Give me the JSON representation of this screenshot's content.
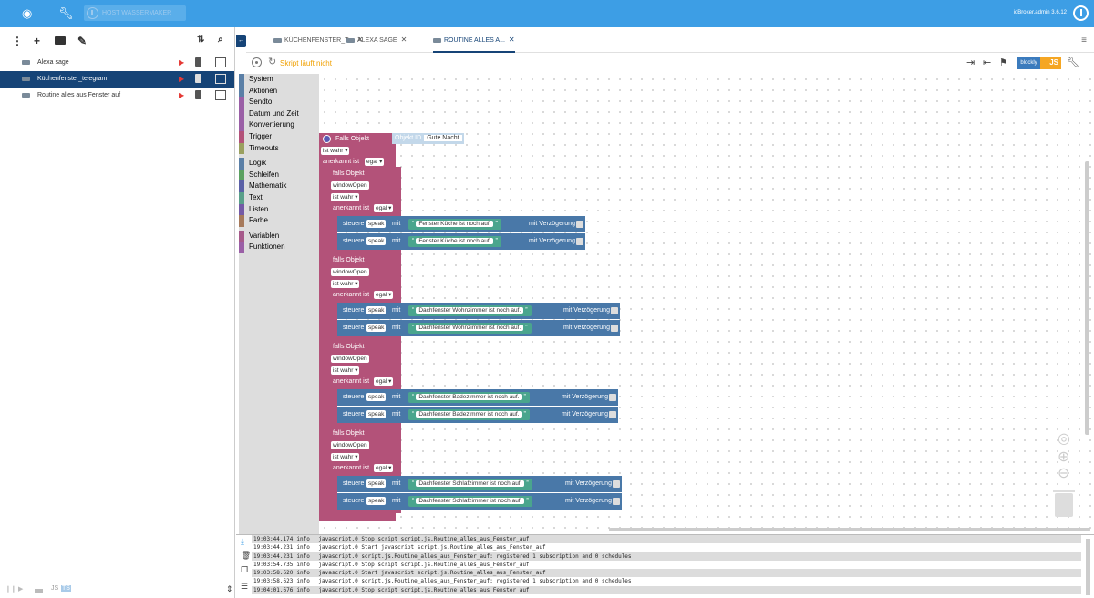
{
  "topbar": {
    "host_button": "HOST WASSERMAKER",
    "admin_label": "ioBroker.admin 3.6.12"
  },
  "sidebar": {
    "scripts": [
      {
        "name": "Alexa sage",
        "selected": false
      },
      {
        "name": "Küchenfenster_telegram",
        "selected": true
      },
      {
        "name": "Routine alles aus Fenster auf",
        "selected": false
      }
    ],
    "footer": {
      "js": "JS",
      "ts": "TS"
    }
  },
  "tabs": [
    {
      "label": "KÜCHENFENSTER_T...",
      "active": false
    },
    {
      "label": "ALEXA SAGE",
      "active": false
    },
    {
      "label": "ROUTINE ALLES A...",
      "active": true
    }
  ],
  "script_toolbar": {
    "status": "Skript läuft nicht",
    "blockly_label": "blockly",
    "js_label": "JS"
  },
  "toolbox": {
    "categories": [
      {
        "label": "System",
        "color": "#5a7fa6"
      },
      {
        "label": "Aktionen",
        "color": "#5a7fa6"
      },
      {
        "label": "Sendto",
        "color": "#9a5fa6"
      },
      {
        "label": "Datum und Zeit",
        "color": "#9a5fa6"
      },
      {
        "label": "Konvertierung",
        "color": "#9a5fa6"
      },
      {
        "label": "Trigger",
        "color": "#b35279"
      },
      {
        "label": "Timeouts",
        "color": "#9aa05f"
      },
      {
        "label": "Logik",
        "color": "#5a7fa6"
      },
      {
        "label": "Schleifen",
        "color": "#5aa060"
      },
      {
        "label": "Mathematik",
        "color": "#5a60a6"
      },
      {
        "label": "Text",
        "color": "#5aa08a"
      },
      {
        "label": "Listen",
        "color": "#745aa6"
      },
      {
        "label": "Farbe",
        "color": "#a6795a"
      },
      {
        "label": "Variablen",
        "color": "#a65a8a"
      },
      {
        "label": "Funktionen",
        "color": "#9a5fa6"
      }
    ]
  },
  "blocks": {
    "main_trigger": {
      "label": "Falls Objekt",
      "object_id_label": "Objekt ID",
      "object_id_value": "Gute Nacht",
      "ist_wahr": "ist wahr",
      "anerkannt_label": "anerkannt ist",
      "anerkannt_value": "egal"
    },
    "groups": [
      {
        "label": "falls Objekt",
        "object": "windowOpen",
        "ist_wahr": "ist wahr",
        "anerkannt_label": "anerkannt ist",
        "anerkannt_value": "egal",
        "actions": [
          {
            "steuere": "steuere",
            "speak": "speak",
            "mit": "mit",
            "text": "Fenster Küche ist noch auf.",
            "delay": "mit Verzögerung"
          },
          {
            "steuere": "steuere",
            "speak": "speak",
            "mit": "mit",
            "text": "Fenster Küche ist noch auf.",
            "delay": "mit Verzögerung"
          }
        ]
      },
      {
        "label": "falls Objekt",
        "object": "windowOpen",
        "ist_wahr": "ist wahr",
        "anerkannt_label": "anerkannt ist",
        "anerkannt_value": "egal",
        "actions": [
          {
            "steuere": "steuere",
            "speak": "speak",
            "mit": "mit",
            "text": "Dachfenster Wohnzimmer ist noch auf.",
            "delay": "mit Verzögerung"
          },
          {
            "steuere": "steuere",
            "speak": "speak",
            "mit": "mit",
            "text": "Dachfenster Wohnzimmer ist noch auf.",
            "delay": "mit Verzögerung"
          }
        ]
      },
      {
        "label": "falls Objekt",
        "object": "windowOpen",
        "ist_wahr": "ist wahr",
        "anerkannt_label": "anerkannt ist",
        "anerkannt_value": "egal",
        "actions": [
          {
            "steuere": "steuere",
            "speak": "speak",
            "mit": "mit",
            "text": "Dachfenster Badezimmer ist noch auf.",
            "delay": "mit Verzögerung"
          },
          {
            "steuere": "steuere",
            "speak": "speak",
            "mit": "mit",
            "text": "Dachfenster Badezimmer ist noch auf.",
            "delay": "mit Verzögerung"
          }
        ]
      },
      {
        "label": "falls Objekt",
        "object": "windowOpen",
        "ist_wahr": "ist wahr",
        "anerkannt_label": "anerkannt ist",
        "anerkannt_value": "egal",
        "actions": [
          {
            "steuere": "steuere",
            "speak": "speak",
            "mit": "mit",
            "text": "Dachfenster Schlafzimmer ist noch auf.",
            "delay": "mit Verzögerung"
          },
          {
            "steuere": "steuere",
            "speak": "speak",
            "mit": "mit",
            "text": "Dachfenster Schlafzimmer ist noch auf.",
            "delay": "mit Verzögerung"
          }
        ]
      }
    ]
  },
  "log": {
    "rows": [
      {
        "time": "19:03:44.174",
        "level": "info",
        "msg": "javascript.0 Stop script script.js.Routine_alles_aus_Fenster_auf"
      },
      {
        "time": "19:03:44.231",
        "level": "info",
        "msg": "javascript.0 Start javascript script.js.Routine_alles_aus_Fenster_auf"
      },
      {
        "time": "19:03:44.231",
        "level": "info",
        "msg": "javascript.0 script.js.Routine_alles_aus_Fenster_auf: registered 1 subscription and 0 schedules"
      },
      {
        "time": "19:03:54.735",
        "level": "info",
        "msg": "javascript.0 Stop script script.js.Routine_alles_aus_Fenster_auf"
      },
      {
        "time": "19:03:58.620",
        "level": "info",
        "msg": "javascript.0 Start javascript script.js.Routine_alles_aus_Fenster_auf"
      },
      {
        "time": "19:03:58.623",
        "level": "info",
        "msg": "javascript.0 script.js.Routine_alles_aus_Fenster_auf: registered 1 subscription and 0 schedules"
      },
      {
        "time": "19:04:01.676",
        "level": "info",
        "msg": "javascript.0 Stop script script.js.Routine_alles_aus_Fenster_auf"
      }
    ]
  }
}
